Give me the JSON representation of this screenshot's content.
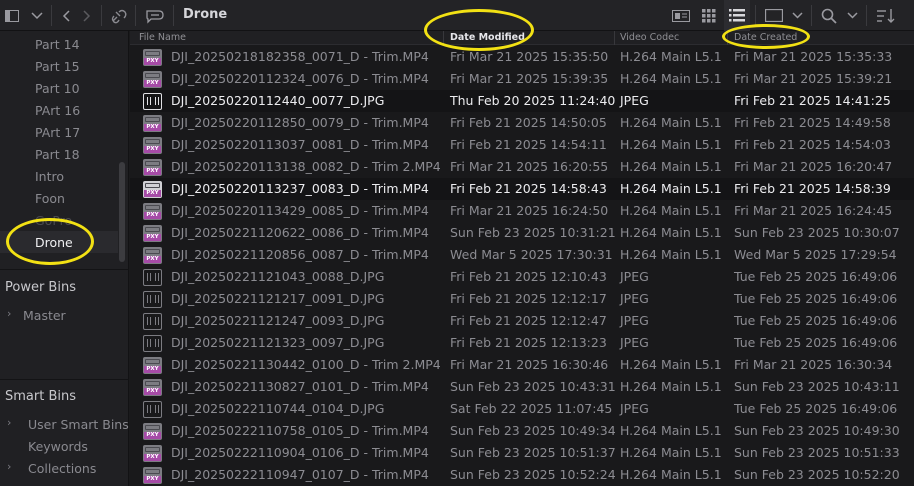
{
  "toolbar": {
    "bin_title": "Drone",
    "icons": [
      "sidebar-toggle-icon",
      "chevron-down-icon",
      "back-icon",
      "forward-icon",
      "link-icon",
      "metadata-icon",
      "metadata-view-icon",
      "thumbnail-view-icon",
      "list-view-icon",
      "filmstrip-view-icon",
      "chevron-down-icon",
      "search-icon",
      "chevron-down-icon",
      "sort-icon"
    ]
  },
  "sidebar": {
    "bins": [
      {
        "label": "Part 14",
        "state": "normal"
      },
      {
        "label": "Part 15",
        "state": "normal"
      },
      {
        "label": "Part 10",
        "state": "normal"
      },
      {
        "label": "PArt 16",
        "state": "normal"
      },
      {
        "label": "PArt 17",
        "state": "normal"
      },
      {
        "label": "Part 18",
        "state": "normal"
      },
      {
        "label": "Intro",
        "state": "normal"
      },
      {
        "label": "Foon",
        "state": "normal"
      },
      {
        "label": "GoPro",
        "state": "dim"
      },
      {
        "label": "Drone",
        "state": "selected"
      }
    ],
    "power_bins": {
      "title": "Power Bins",
      "items": [
        "Master"
      ]
    },
    "smart_bins": {
      "title": "Smart Bins",
      "items": [
        "User Smart Bins",
        "Keywords",
        "Collections"
      ]
    }
  },
  "list": {
    "columns": [
      "File Name",
      "Date Modified",
      "Video Codec",
      "Date Created"
    ],
    "sorted_column": "Date Modified",
    "rows": [
      {
        "icon": "video",
        "name": "DJI_20250218182358_0071_D - Trim.MP4",
        "modified": "Fri Mar 21 2025 15:35:50",
        "codec": "H.264 Main L5.1",
        "created": "Fri Mar 21 2025 15:35:33",
        "active": false
      },
      {
        "icon": "video",
        "name": "DJI_20250220112324_0076_D - Trim.MP4",
        "modified": "Fri Mar 21 2025 15:39:35",
        "codec": "H.264 Main L5.1",
        "created": "Fri Mar 21 2025 15:39:21",
        "active": false
      },
      {
        "icon": "image",
        "name": "DJI_20250220112440_0077_D.JPG",
        "modified": "Thu Feb 20 2025 11:24:40",
        "codec": "JPEG",
        "created": "Fri Feb 21 2025 14:41:25",
        "active": true
      },
      {
        "icon": "video",
        "name": "DJI_20250220112850_0079_D - Trim.MP4",
        "modified": "Fri Feb 21 2025 14:50:05",
        "codec": "H.264 Main L5.1",
        "created": "Fri Feb 21 2025 14:49:58",
        "active": false
      },
      {
        "icon": "video",
        "name": "DJI_20250220113037_0081_D - Trim.MP4",
        "modified": "Fri Feb 21 2025 14:54:11",
        "codec": "H.264 Main L5.1",
        "created": "Fri Feb 21 2025 14:54:03",
        "active": false
      },
      {
        "icon": "video",
        "name": "DJI_20250220113138_0082_D - Trim 2.MP4",
        "modified": "Fri Mar 21 2025 16:20:55",
        "codec": "H.264 Main L5.1",
        "created": "Fri Mar 21 2025 16:20:47",
        "active": false
      },
      {
        "icon": "video",
        "name": "DJI_20250220113237_0083_D - Trim.MP4",
        "modified": "Fri Feb 21 2025 14:58:43",
        "codec": "H.264 Main L5.1",
        "created": "Fri Feb 21 2025 14:58:39",
        "active": true
      },
      {
        "icon": "video",
        "name": "DJI_20250220113429_0085_D - Trim.MP4",
        "modified": "Fri Mar 21 2025 16:24:50",
        "codec": "H.264 Main L5.1",
        "created": "Fri Mar 21 2025 16:24:45",
        "active": false
      },
      {
        "icon": "video",
        "name": "DJI_20250221120622_0086_D - Trim.MP4",
        "modified": "Sun Feb 23 2025 10:31:21",
        "codec": "H.264 Main L5.1",
        "created": "Sun Feb 23 2025 10:30:07",
        "active": false
      },
      {
        "icon": "video",
        "name": "DJI_20250221120856_0087_D - Trim.MP4",
        "modified": "Wed Mar 5 2025 17:30:31",
        "codec": "H.264 Main L5.1",
        "created": "Wed Mar 5 2025 17:29:54",
        "active": false
      },
      {
        "icon": "image",
        "name": "DJI_20250221121043_0088_D.JPG",
        "modified": "Fri Feb 21 2025 12:10:43",
        "codec": "JPEG",
        "created": "Tue Feb 25 2025 16:49:06",
        "active": false
      },
      {
        "icon": "image",
        "name": "DJI_20250221121217_0091_D.JPG",
        "modified": "Fri Feb 21 2025 12:12:17",
        "codec": "JPEG",
        "created": "Tue Feb 25 2025 16:49:06",
        "active": false
      },
      {
        "icon": "image",
        "name": "DJI_20250221121247_0093_D.JPG",
        "modified": "Fri Feb 21 2025 12:12:47",
        "codec": "JPEG",
        "created": "Tue Feb 25 2025 16:49:06",
        "active": false
      },
      {
        "icon": "image",
        "name": "DJI_20250221121323_0097_D.JPG",
        "modified": "Fri Feb 21 2025 12:13:23",
        "codec": "JPEG",
        "created": "Tue Feb 25 2025 16:49:06",
        "active": false
      },
      {
        "icon": "video",
        "name": "DJI_20250221130442_0100_D - Trim 2.MP4",
        "modified": "Fri Mar 21 2025 16:30:46",
        "codec": "H.264 Main L5.1",
        "created": "Fri Mar 21 2025 16:30:34",
        "active": false
      },
      {
        "icon": "video",
        "name": "DJI_20250221130827_0101_D - Trim.MP4",
        "modified": "Sun Feb 23 2025 10:43:31",
        "codec": "H.264 Main L5.1",
        "created": "Sun Feb 23 2025 10:43:11",
        "active": false
      },
      {
        "icon": "image",
        "name": "DJI_20250222110744_0104_D.JPG",
        "modified": "Sat Feb 22 2025 11:07:45",
        "codec": "JPEG",
        "created": "Tue Feb 25 2025 16:49:06",
        "active": false
      },
      {
        "icon": "video",
        "name": "DJI_20250222110758_0105_D - Trim.MP4",
        "modified": "Sun Feb 23 2025 10:49:34",
        "codec": "H.264 Main L5.1",
        "created": "Sun Feb 23 2025 10:49:30",
        "active": false
      },
      {
        "icon": "video",
        "name": "DJI_20250222110904_0106_D - Trim.MP4",
        "modified": "Sun Feb 23 2025 10:51:37",
        "codec": "H.264 Main L5.1",
        "created": "Sun Feb 23 2025 10:51:33",
        "active": false
      },
      {
        "icon": "video",
        "name": "DJI_20250222110947_0107_D - Trim.MP4",
        "modified": "Sun Feb 23 2025 10:52:24",
        "codec": "H.264 Main L5.1",
        "created": "Sun Feb 23 2025 10:52:20",
        "active": false
      }
    ]
  },
  "icon_labels": {
    "proxy": "PXY"
  },
  "colors": {
    "annotation": "#f2e114",
    "proxy_badge": "#a64ba7"
  }
}
